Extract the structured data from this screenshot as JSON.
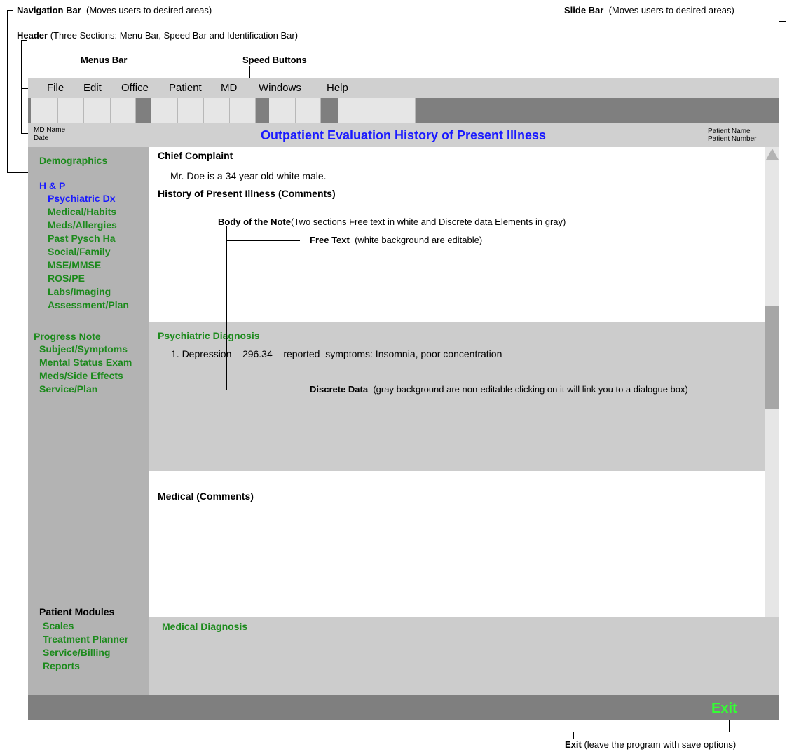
{
  "annotations": {
    "navigation_bar": {
      "bold": "Navigation Bar",
      "desc": "(Moves users to desired areas)"
    },
    "slide_bar": {
      "bold": "Slide Bar",
      "desc": "(Moves users to desired areas)"
    },
    "header": {
      "bold": "Header",
      "desc": "(Three Sections: Menu Bar, Speed Bar and Identification Bar)"
    },
    "menus_bar": "Menus Bar",
    "speed_buttons": "Speed Buttons",
    "body_of_note": {
      "bold": "Body of the Note",
      "desc": "(Two sections Free text in white and Discrete data Elements in gray)"
    },
    "free_text": {
      "bold": "Free Text",
      "desc": "(white background  are editable)"
    },
    "discrete_data": {
      "bold": "Discrete Data",
      "desc": "(gray background  are  non-editable clicking on it will link you to a dialogue box)"
    },
    "exit": {
      "bold": "Exit",
      "desc": "(leave the program with save options)"
    }
  },
  "menu": [
    "File",
    "Edit",
    "Office",
    "Patient",
    "MD",
    "Windows",
    "Help"
  ],
  "id_bar": {
    "md_name": "MD Name",
    "date": "Date",
    "title": "Outpatient Evaluation History of Present Illness",
    "patient_name": "Patient Name",
    "patient_number": "Patient Number"
  },
  "nav": {
    "demographics": "Demographics",
    "hp": "H & P",
    "hp_items": [
      "Psychiatric Dx",
      "Medical/Habits",
      "Meds/Allergies",
      "Past Pysch Ha",
      "Social/Family",
      "MSE/MMSE",
      "ROS/PE",
      "Labs/Imaging",
      "Assessment/Plan"
    ],
    "progress_note": "Progress Note",
    "progress_items": [
      "Subject/Symptoms",
      "Mental Status Exam",
      "Meds/Side Effects",
      "Service/Plan"
    ],
    "patient_modules": "Patient Modules",
    "module_items": [
      "Scales",
      "Treatment Planner",
      "Service/Billing",
      "Reports"
    ]
  },
  "note": {
    "chief_complaint_label": "Chief Complaint",
    "chief_complaint_text": "Mr. Doe is a 34 year old white male.",
    "hpi_label": "History of Present Illness (Comments)",
    "psych_dx_label": "Psychiatric Diagnosis",
    "psych_dx_line": "1. Depression    296.34    reported  symptoms: Insomnia, poor concentration",
    "medical_label": "Medical  (Comments)",
    "medical_dx_label": "Medical Diagnosis"
  },
  "exit_label": "Exit",
  "colors": {
    "nav_green": "#1c8a1c",
    "title_blue": "#1a1aff",
    "exit_green": "#33ff33"
  }
}
